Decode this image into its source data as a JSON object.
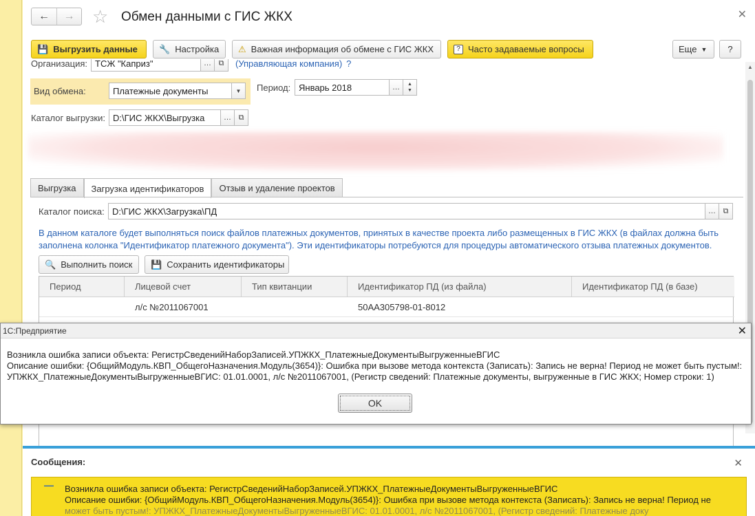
{
  "window": {
    "title": "Обмен данными с ГИС ЖКХ"
  },
  "toolbar": {
    "upload_label": "Выгрузить данные",
    "settings_label": "Настройка",
    "important_label": "Важная информация об обмене с ГИС ЖКХ",
    "faq_label": "Часто задаваемые вопросы",
    "more_label": "Еще",
    "help_label": "?"
  },
  "form": {
    "organization_label": "Организация:",
    "organization_value": "ТСЖ \"Каприз\"",
    "organization_link": "(Управляющая компания)",
    "organization_help": "?",
    "exchange_type_label": "Вид обмена:",
    "exchange_type_value": "Платежные документы",
    "period_label": "Период:",
    "period_value": "Январь 2018",
    "catalog_label": "Каталог выгрузки:",
    "catalog_value": "D:\\ГИС ЖКХ\\Выгрузка"
  },
  "tabs": [
    {
      "label": "Выгрузка"
    },
    {
      "label": "Загрузка идентификаторов"
    },
    {
      "label": "Отзыв и удаление проектов"
    }
  ],
  "search": {
    "catalog_label": "Каталог поиска:",
    "catalog_value": "D:\\ГИС ЖКХ\\Загрузка\\ПД",
    "info_text": "В данном каталоге будет выполняться поиск файлов платежных документов, принятых в качестве проекта либо размещенных в ГИС ЖКХ (в файлах должна быть заполнена колонка \"Идентификатор платежного документа\"). Эти идентификаторы потребуются для процедуры автоматического отзыва платежных документов.",
    "run_label": "Выполнить поиск",
    "save_label": "Сохранить идентификаторы"
  },
  "table": {
    "columns": [
      "Период",
      "Лицевой счет",
      "Тип квитанции",
      "Идентификатор ПД (из файла)",
      "Идентификатор ПД (в базе)"
    ],
    "rows": [
      {
        "period": "",
        "account": "л/с №2011067001",
        "type": "",
        "id_file": "50АА305798-01-8012",
        "id_db": ""
      }
    ]
  },
  "dialog": {
    "title": "1С:Предприятие",
    "line1": "Возникла ошибка записи объекта: РегистрСведенийНаборЗаписей.УПЖКХ_ПлатежныеДокументыВыгруженныеВГИС",
    "line2": "Описание ошибки: {ОбщийМодуль.КВП_ОбщегоНазначения.Модуль(3654)}: Ошибка при вызове метода контекста (Записать): Запись не верна! Период не может быть пустым!:",
    "line3": "УПЖКХ_ПлатежныеДокументыВыгруженныеВГИС: 01.01.0001, л/с №2011067001,  (Регистр сведений: Платежные документы, выгруженные в ГИС ЖКХ; Номер строки: 1)",
    "ok_label": "OK"
  },
  "messages": {
    "title": "Сообщения:",
    "line1": "Возникла ошибка записи объекта: РегистрСведенийНаборЗаписей.УПЖКХ_ПлатежныеДокументыВыгруженныеВГИС",
    "line2": "Описание ошибки: {ОбщийМодуль.КВП_ОбщегоНазначения.Модуль(3654)}: Ошибка при вызове метода контекста (Записать): Запись не верна! Период не",
    "line3": "может быть пустым!: УПЖКХ_ПлатежныеДокументыВыгруженныеВГИС: 01.01.0001, л/с №2011067001,  (Регистр сведений: Платежные доку"
  },
  "colors": {
    "accent_yellow": "#f5d31b",
    "link_blue": "#2b63b4",
    "messages_border": "#3aa0d9",
    "highlight": "#fbeaaf"
  }
}
